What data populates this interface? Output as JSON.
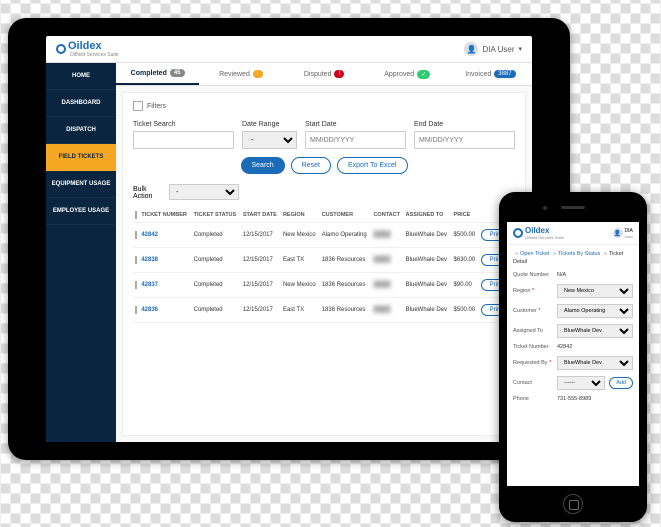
{
  "brand": {
    "name": "Oildex",
    "sub": "Oilfield Services Suite"
  },
  "user": {
    "name": "DIA User"
  },
  "nav": [
    "HOME",
    "DASHBOARD",
    "DISPATCH",
    "FIELD TICKETS",
    "EQUIPMENT USAGE",
    "EMPLOYEE USAGE"
  ],
  "tabs": [
    {
      "label": "Completed",
      "count": "45"
    },
    {
      "label": "Reviewed",
      "count": ""
    },
    {
      "label": "Disputed",
      "count": ""
    },
    {
      "label": "Approved",
      "count": ""
    },
    {
      "label": "Invoiced",
      "count": "3887"
    }
  ],
  "filters": {
    "label": "Filters"
  },
  "search": {
    "ticket": "Ticket Search",
    "range": "Date Range",
    "start": "Start Date",
    "end": "End Date",
    "ph": "MM/DD/YYYY",
    "rangeOpt": "-"
  },
  "buttons": {
    "search": "Search",
    "reset": "Reset",
    "export": "Export To Excel",
    "print": "Print",
    "add": "Add"
  },
  "bulk": {
    "label": "Bulk Action",
    "opt": "-"
  },
  "cols": [
    "",
    "TICKET NUMBER",
    "TICKET STATUS",
    "START DATE",
    "REGION",
    "CUSTOMER",
    "CONTACT",
    "ASSIGNED TO",
    "PRICE",
    ""
  ],
  "rows": [
    {
      "num": "42842",
      "status": "Completed",
      "date": "12/15/2017",
      "region": "New Mexico",
      "cust": "Alamo Operating",
      "assigned": "BlueWhale Dev",
      "price": "$500.00"
    },
    {
      "num": "42838",
      "status": "Completed",
      "date": "12/15/2017",
      "region": "East TX",
      "cust": "1836 Resources",
      "assigned": "BlueWhale Dev",
      "price": "$630.00"
    },
    {
      "num": "42837",
      "status": "Completed",
      "date": "12/15/2017",
      "region": "New Mexico",
      "cust": "1836 Resources",
      "assigned": "BlueWhale Dev",
      "price": "$90.00"
    },
    {
      "num": "42836",
      "status": "Completed",
      "date": "12/15/2017",
      "region": "East TX",
      "cust": "1836 Resources",
      "assigned": "BlueWhale Dev",
      "price": "$500.00"
    }
  ],
  "phone": {
    "userShort": "DIA",
    "userSub": "User",
    "crumb": {
      "a": "Open Ticket",
      "b": "Tickets By Status",
      "c": "Ticket Detail"
    },
    "fields": {
      "quote": {
        "label": "Quote Number",
        "val": "N/A"
      },
      "region": {
        "label": "Region",
        "val": "New Mexico"
      },
      "customer": {
        "label": "Customer",
        "val": "Alamo Operating"
      },
      "assigned": {
        "label": "Assigned To",
        "val": "BlueWhale Dev"
      },
      "ticket": {
        "label": "Ticket Number",
        "val": "42842"
      },
      "requested": {
        "label": "Requested By",
        "val": "BlueWhale Dev"
      },
      "contact": {
        "label": "Contact",
        "val": "------"
      },
      "phone": {
        "label": "Phone",
        "val": "731-555-8989"
      }
    }
  }
}
